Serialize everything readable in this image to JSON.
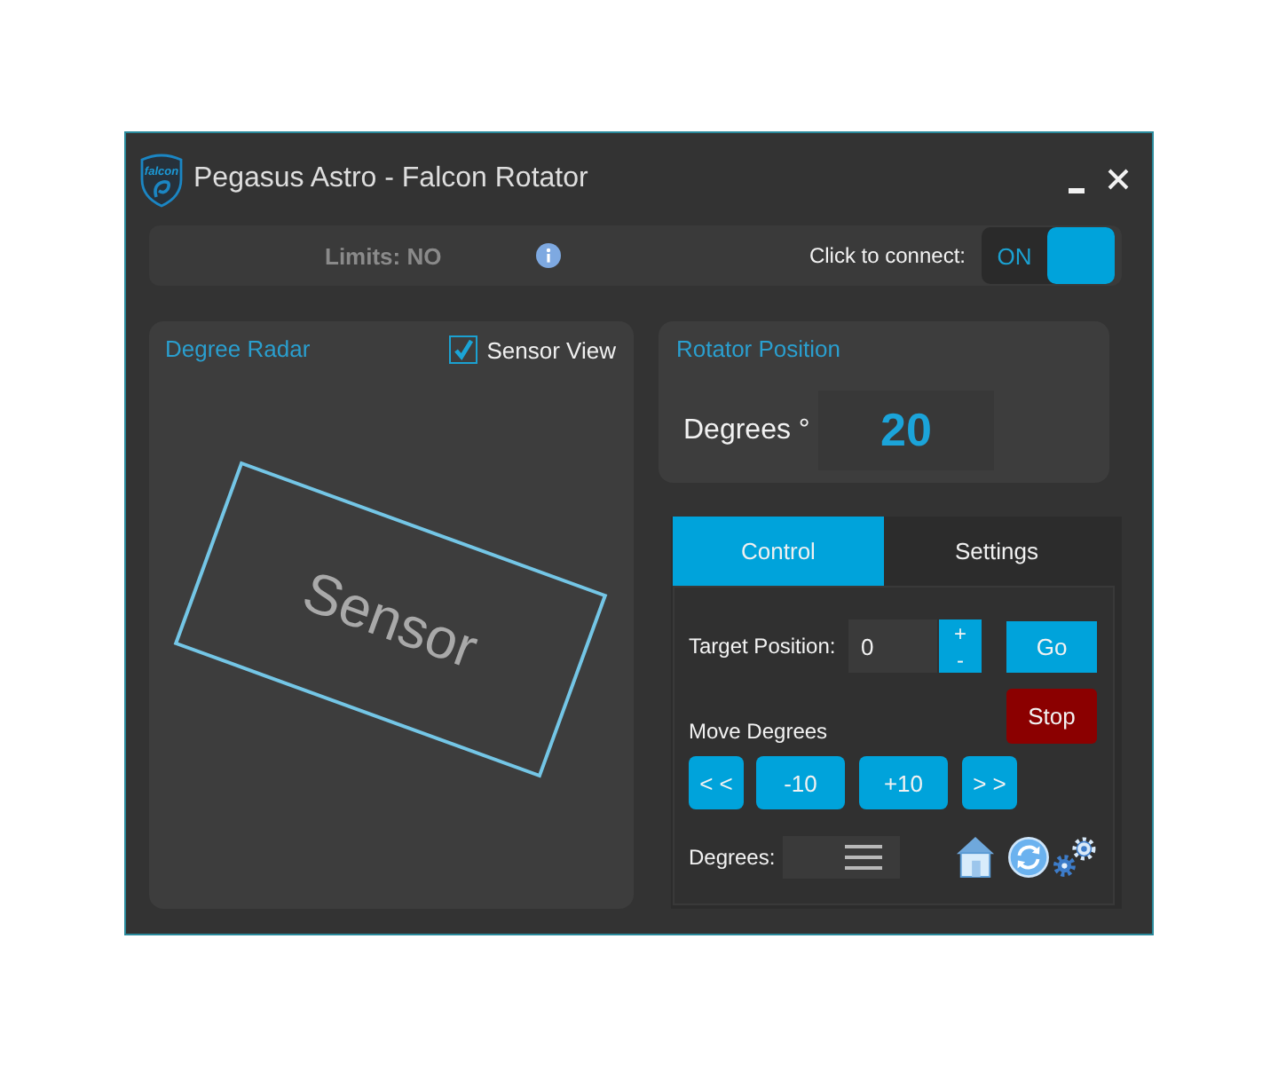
{
  "window": {
    "title": "Pegasus Astro - Falcon Rotator",
    "logo_text": "falcon"
  },
  "status_bar": {
    "limits": "Limits: NO",
    "connect_label": "Click to connect:",
    "switch_text": "ON",
    "connected": true
  },
  "radar": {
    "title": "Degree Radar",
    "sensor_view": {
      "label": "Sensor View",
      "checked": true
    },
    "sensor_label": "Sensor"
  },
  "rotator_position": {
    "title": "Rotator Position",
    "label": "Degrees °",
    "value": "20"
  },
  "tabs": [
    {
      "label": "Control",
      "selected": true
    },
    {
      "label": "Settings",
      "selected": false
    }
  ],
  "control": {
    "target_label": "Target Position:",
    "target_value": "0",
    "increment": "+",
    "decrement": "-",
    "go_button": "Go",
    "stop_button": "Stop",
    "move_label": "Move Degrees",
    "move_buttons": [
      "< <",
      "-10",
      "+10",
      "> >"
    ],
    "degrees_label": "Degrees:"
  }
}
